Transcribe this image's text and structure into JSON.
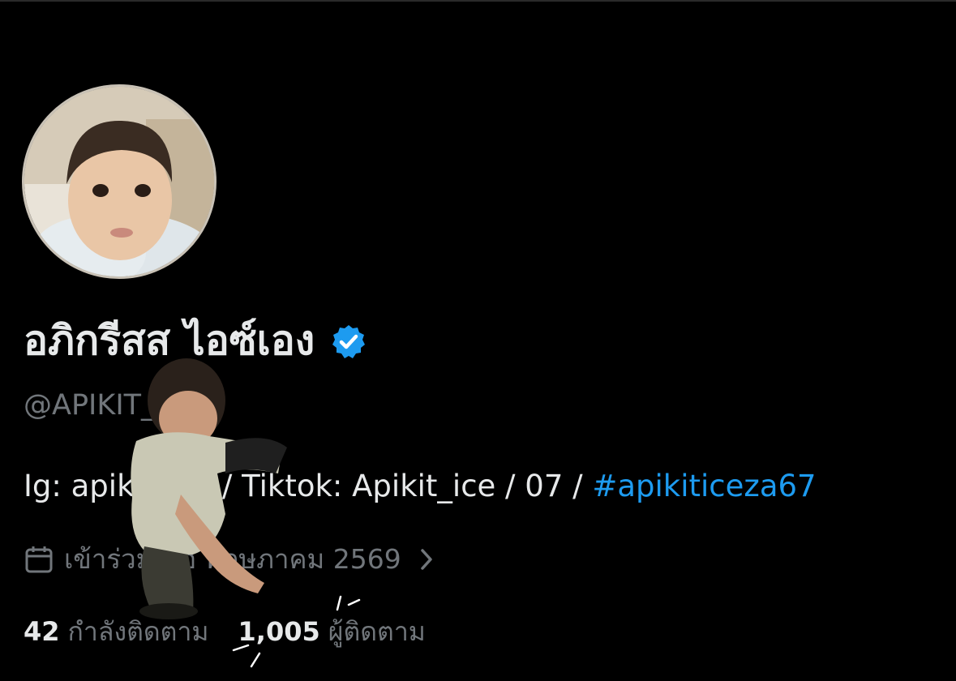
{
  "profile": {
    "display_name": "อภิกรีสส ไอซ์เอง",
    "verified_badge_icon": "verified-check-icon",
    "handle": "@APIKIT_ICE",
    "bio_text": "Ig: apikit_ice / Tiktok: Apikit_ice / 07 / ",
    "bio_hashtag": "#apikiticeza67",
    "joined_text": "เข้าร่วมเมื่อ พฤษภาคม 2569",
    "following_count": "42",
    "following_label": "กำลังติดตาม",
    "followers_count": "1,005",
    "followers_label": "ผู้ติดตาม"
  },
  "colors": {
    "background": "#000000",
    "primary_text": "#e7e9ea",
    "secondary_text": "#71767b",
    "accent": "#1d9bf0"
  },
  "icons": {
    "calendar": "calendar-icon",
    "chevron": "chevron-right-icon"
  }
}
